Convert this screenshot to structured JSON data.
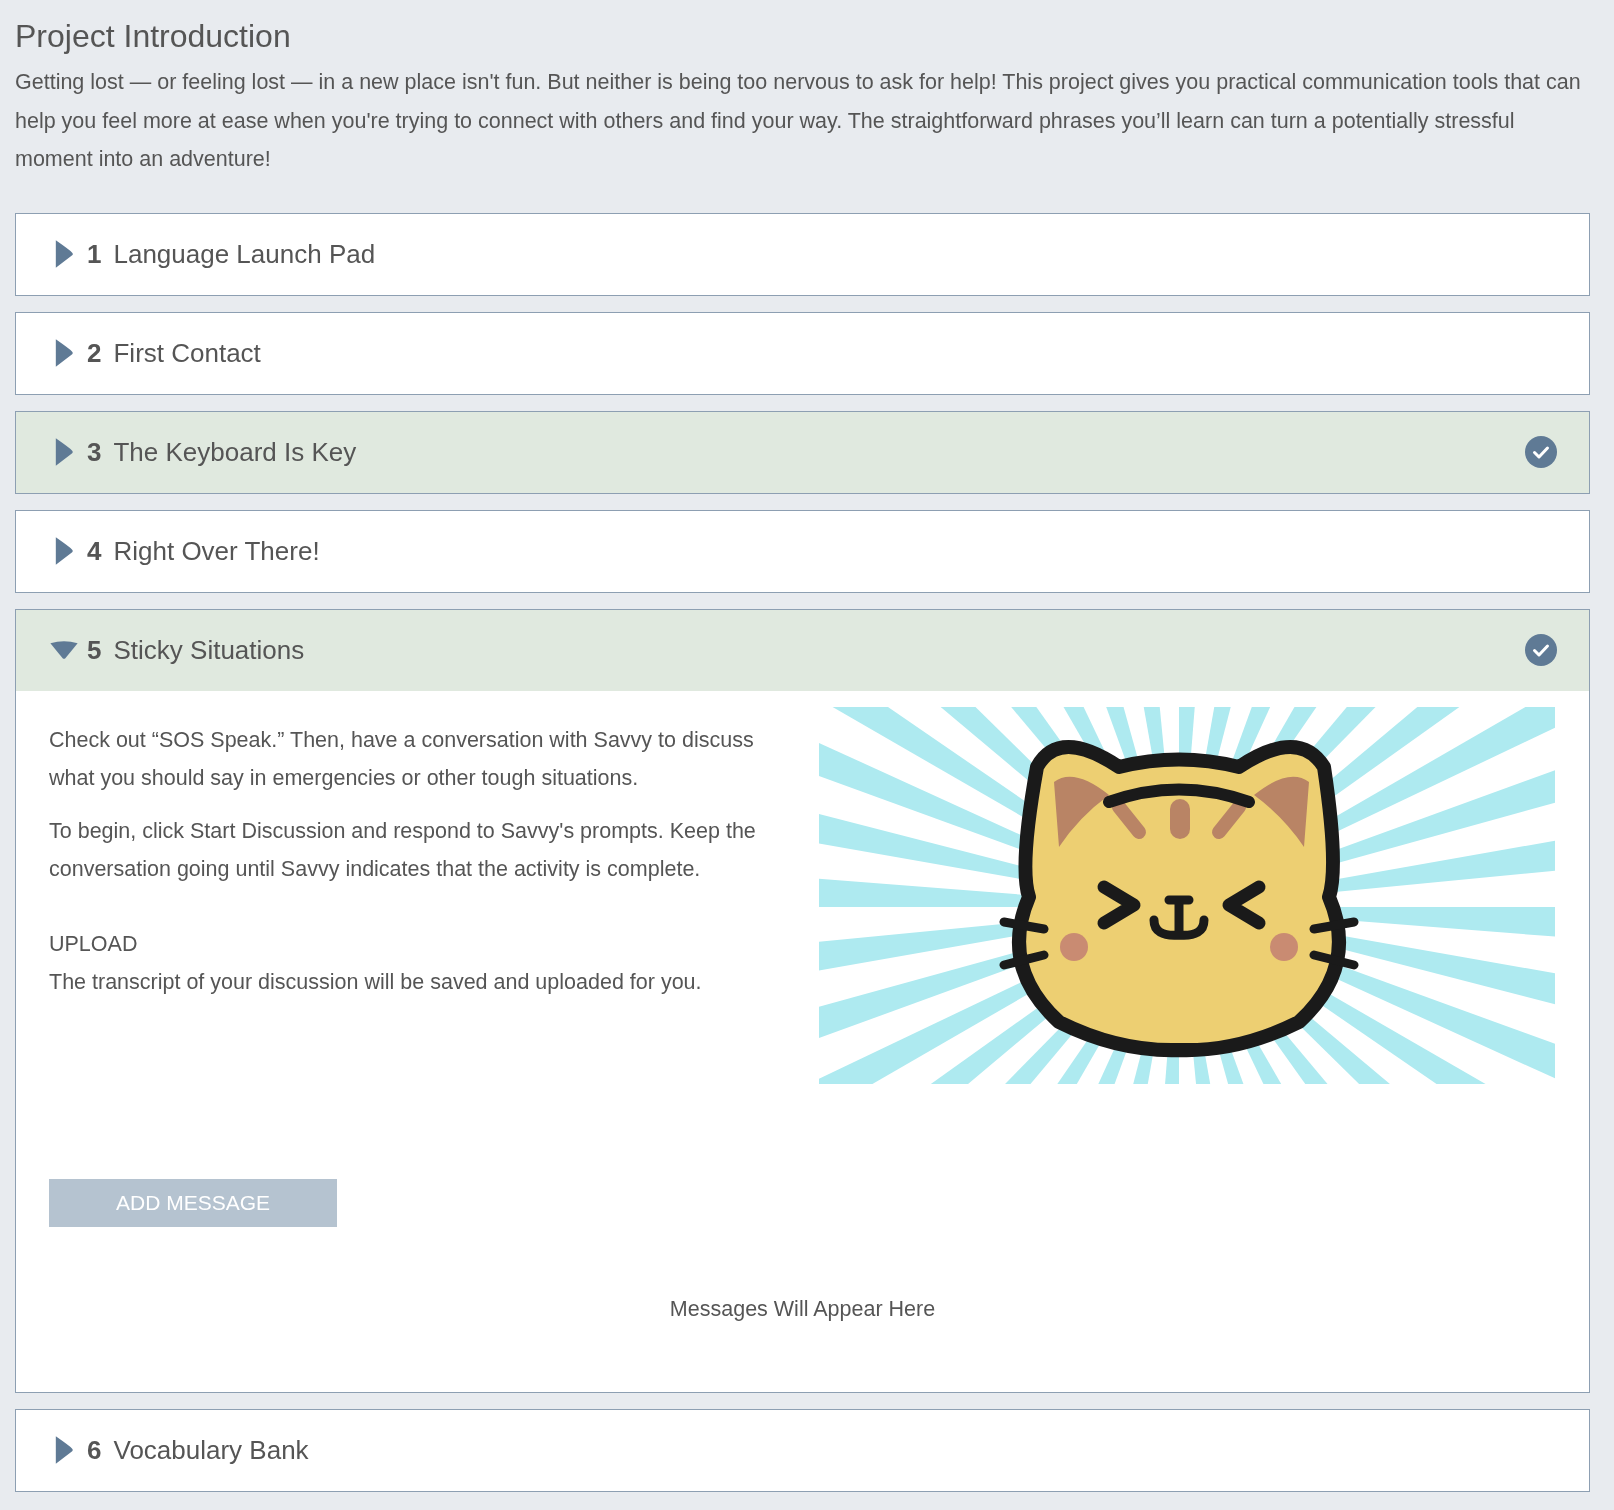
{
  "title": "Project Introduction",
  "intro": "Getting lost — or feeling lost — in a new place isn't fun. But neither is being too nervous to ask for help! This project gives you practical communication tools that can help you feel more at ease when you're trying to connect with others and find your way. The straightforward phrases you’ll learn can turn a potentially stressful moment into an adventure!",
  "sections": [
    {
      "number": "1",
      "title": "Language Launch Pad",
      "expanded": false,
      "completed": false
    },
    {
      "number": "2",
      "title": "First Contact",
      "expanded": false,
      "completed": false
    },
    {
      "number": "3",
      "title": "The Keyboard Is Key",
      "expanded": false,
      "completed": true
    },
    {
      "number": "4",
      "title": "Right Over There!",
      "expanded": false,
      "completed": false
    },
    {
      "number": "5",
      "title": "Sticky Situations",
      "expanded": true,
      "completed": true,
      "content": {
        "paragraphs": [
          "Check out “SOS Speak.” Then, have a conversation with Savvy to discuss what you should say in emergencies or other tough situations.",
          "To begin, click Start Discussion and respond to Savvy's prompts. Keep the conversation going until Savvy indicates that the activity is complete."
        ],
        "upload_heading": "UPLOAD",
        "upload_text": "The transcript of your discussion will be saved and uploaded for you.",
        "button": "ADD MESSAGE",
        "messages_placeholder": "Messages Will Appear Here"
      }
    },
    {
      "number": "6",
      "title": "Vocabulary Bank",
      "expanded": false,
      "completed": false
    }
  ]
}
